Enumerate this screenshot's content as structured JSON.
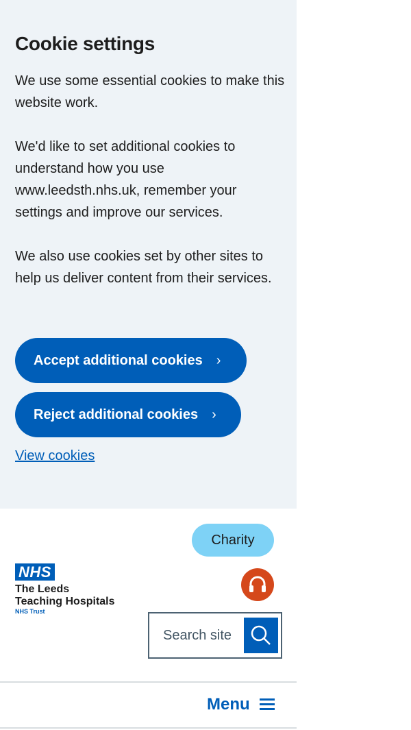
{
  "cookie_banner": {
    "title": "Cookie settings",
    "paragraphs": [
      "We use some essential cookies to make this website work.",
      "We'd like to set additional cookies to understand how you use www.leedsth.nhs.uk, remember your settings and improve our services.",
      "We also use cookies set by other sites to help us deliver content from their services."
    ],
    "accept_label": "Accept additional cookies",
    "reject_label": "Reject additional cookies",
    "view_cookies_label": "View cookies"
  },
  "header": {
    "charity_label": "Charity",
    "logo": {
      "nhs": "NHS",
      "org_line1": "The Leeds",
      "org_line2": "Teaching Hospitals",
      "trust": "NHS Trust"
    },
    "search_placeholder": "Search site",
    "menu_label": "Menu"
  },
  "icons": {
    "chevron": "chevron-right-icon",
    "audio": "headphones-icon",
    "search": "search-icon",
    "menu": "hamburger-icon"
  },
  "colors": {
    "primary": "#005eb8",
    "banner_bg": "#eef3f7",
    "charity_bg": "#7ed2f6",
    "audio_bg": "#d5481b"
  }
}
